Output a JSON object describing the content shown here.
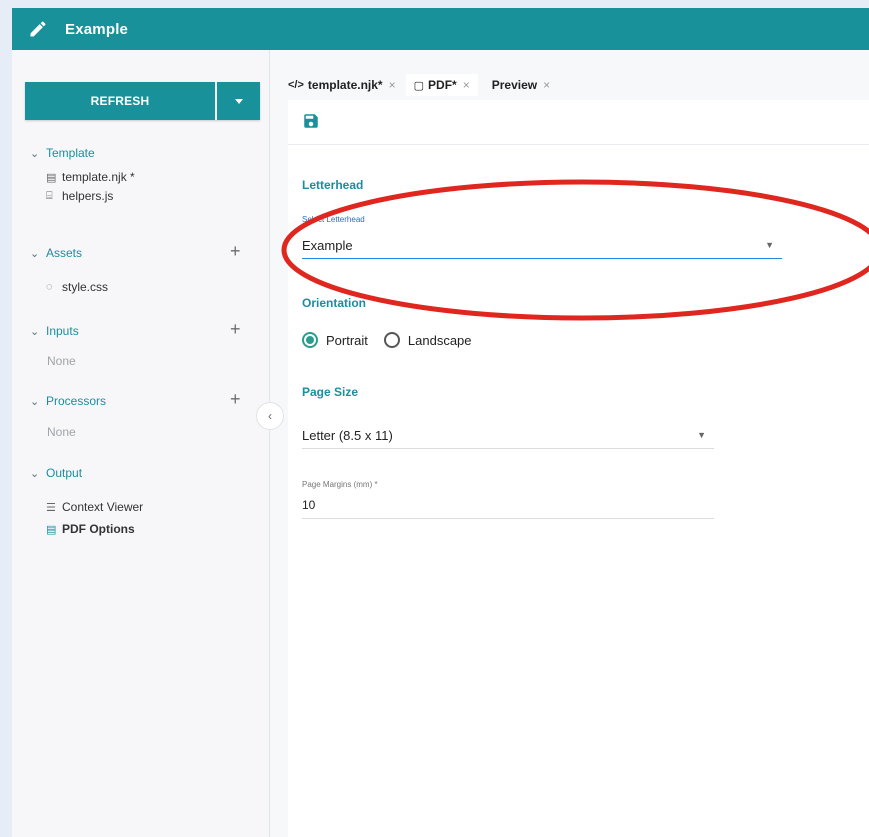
{
  "header": {
    "title": "Example",
    "accent": "#18919a"
  },
  "sidebar": {
    "refresh_label": "REFRESH",
    "sections": {
      "template": {
        "label": "Template",
        "files": [
          "template.njk *",
          "helpers.js"
        ]
      },
      "assets": {
        "label": "Assets",
        "files": [
          "style.css"
        ]
      },
      "inputs": {
        "label": "Inputs",
        "empty": "None"
      },
      "processors": {
        "label": "Processors",
        "empty": "None"
      },
      "output": {
        "label": "Output",
        "items": [
          "Context Viewer",
          "PDF Options"
        ]
      }
    }
  },
  "tabs": [
    {
      "label": "template.njk*",
      "icon": "code-icon"
    },
    {
      "label": "PDF*",
      "icon": "document-icon"
    },
    {
      "label": "Preview",
      "icon": ""
    }
  ],
  "form": {
    "letterhead": {
      "heading": "Letterhead",
      "select_label": "Select Letterhead",
      "value": "Example"
    },
    "orientation": {
      "heading": "Orientation",
      "options": [
        "Portrait",
        "Landscape"
      ],
      "selected": "Portrait"
    },
    "page_size": {
      "heading": "Page Size",
      "value": "Letter (8.5 x 11)"
    },
    "margins": {
      "label": "Page Margins (mm) *",
      "value": "10"
    }
  },
  "annotation_color": "#e0271f"
}
